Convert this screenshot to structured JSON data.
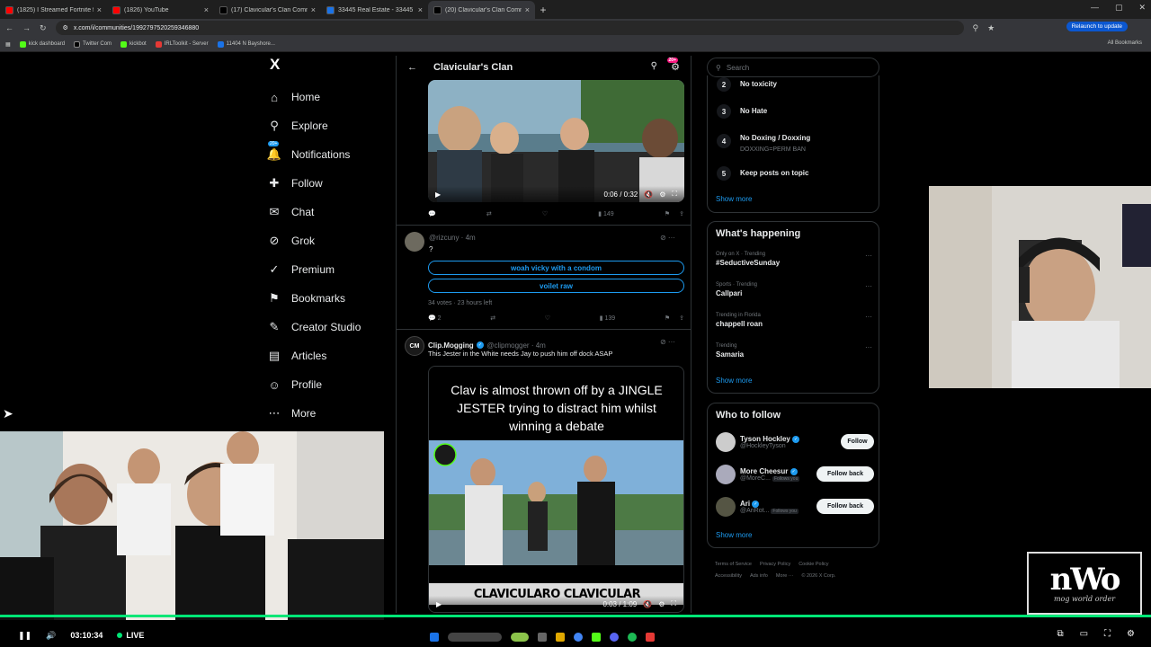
{
  "browser": {
    "tabs": [
      {
        "title": "(1825) I Streamed Fortnite for 1...",
        "color": "#ff0000",
        "active": false
      },
      {
        "title": "(1826) YouTube",
        "color": "#ff0000",
        "active": false
      },
      {
        "title": "(17) Clavicular's Clan Communi...",
        "color": "#000000",
        "active": false
      },
      {
        "title": "33445 Real Estate - 33445 Hom...",
        "color": "#1a73e8",
        "active": false
      },
      {
        "title": "(20) Clavicular's Clan Communi...",
        "color": "#000000",
        "active": true
      }
    ],
    "url": "x.com/i/communities/1992797520259346880",
    "relaunch": "Relaunch to update",
    "bookmarks": [
      "kick dashboard",
      "Twitter Com",
      "kickbot",
      "IRLToolkit - Server",
      "11404 N Bayshore..."
    ],
    "all_bookmarks": "All Bookmarks"
  },
  "nav": {
    "logo": "X",
    "items": [
      {
        "label": "Home",
        "icon": "⌂"
      },
      {
        "label": "Explore",
        "icon": "⚲"
      },
      {
        "label": "Notifications",
        "icon": "🔔",
        "badge": "20+"
      },
      {
        "label": "Follow",
        "icon": "✚"
      },
      {
        "label": "Chat",
        "icon": "✉"
      },
      {
        "label": "Grok",
        "icon": "⊘"
      },
      {
        "label": "Premium",
        "icon": "✓"
      },
      {
        "label": "Bookmarks",
        "icon": "⚑"
      },
      {
        "label": "Creator Studio",
        "icon": "✎"
      },
      {
        "label": "Articles",
        "icon": "▤"
      },
      {
        "label": "Profile",
        "icon": "☺"
      },
      {
        "label": "More",
        "icon": "⋯"
      }
    ]
  },
  "community": {
    "title": "Clavicular's Clan",
    "badge": "20+",
    "post1": {
      "time": "0:06 / 0:32",
      "views": "149"
    },
    "post2": {
      "handle": "@rizcuny · 4m",
      "text": "?",
      "options": [
        "woah vicky with a condom",
        "voilet raw"
      ],
      "meta": "34 votes · 23 hours left",
      "replies": "2",
      "views": "139"
    },
    "post3": {
      "name": "Clip.Mogging",
      "handle": "@clipmogger · 4m",
      "text": "This Jester in the White needs Jay to push him off dock ASAP",
      "avatar": "CM",
      "headline": "Clav is almost thrown off by a JINGLE JESTER trying to distract him whilst winning a debate",
      "banner": "CLAVICULARO  CLAVICULAR",
      "time": "0:03 / 1:09"
    }
  },
  "right": {
    "search_placeholder": "Search",
    "rules": [
      {
        "n": "2",
        "t": "No toxicity",
        "sub": ""
      },
      {
        "n": "3",
        "t": "No Hate",
        "sub": ""
      },
      {
        "n": "4",
        "t": "No Doxing / Doxxing",
        "sub": "DOXXING=PERM BAN"
      },
      {
        "n": "5",
        "t": "Keep posts on topic",
        "sub": ""
      }
    ],
    "show_more": "Show more",
    "happening_title": "What's happening",
    "trends": [
      {
        "c": "Only on X · Trending",
        "t": "#SeductiveSunday"
      },
      {
        "c": "Sports · Trending",
        "t": "Callpari"
      },
      {
        "c": "Trending in Florida",
        "t": "chappell roan"
      },
      {
        "c": "Trending",
        "t": "Samaria"
      }
    ],
    "who_title": "Who to follow",
    "who": [
      {
        "name": "Tyson Hockley",
        "handle": "@HockleyTyson",
        "btn": "Follow",
        "fy": ""
      },
      {
        "name": "More Cheesur",
        "handle": "@MoreC...",
        "btn": "Follow back",
        "fy": "Follows you"
      },
      {
        "name": "Ari",
        "handle": "@AriRot...",
        "btn": "Follow back",
        "fy": "Follows you"
      }
    ],
    "footer": [
      "Terms of Service",
      "Privacy Policy",
      "Cookie Policy",
      "Accessibility",
      "Ads info",
      "More ···",
      "© 2026 X Corp."
    ]
  },
  "stream": {
    "time": "03:10:34",
    "live": "LIVE",
    "logo": "nWo",
    "logo_sub": "mog world order"
  }
}
